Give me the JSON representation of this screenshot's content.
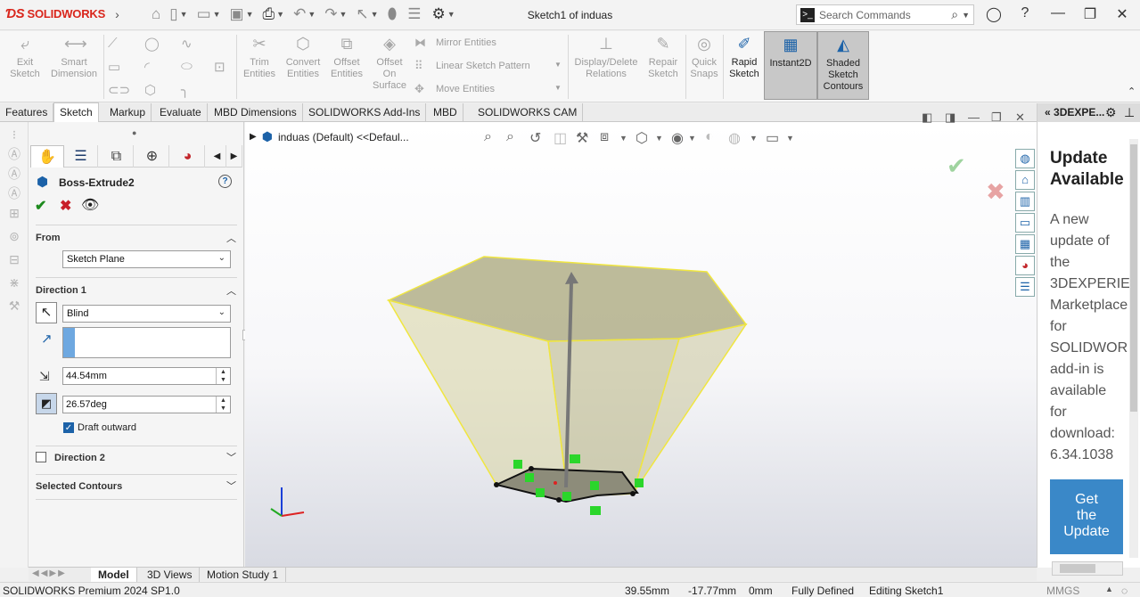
{
  "app": {
    "brand": "SOLIDWORKS",
    "title": "Sketch1 of induas"
  },
  "search": {
    "placeholder": "Search Commands"
  },
  "ribbon": {
    "exit_sketch": "Exit\nSketch",
    "smart_dimension": "Smart\nDimension",
    "trim": "Trim\nEntities",
    "convert": "Convert\nEntities",
    "offset": "Offset\nEntities",
    "offset_surface": "Offset\nOn\nSurface",
    "mirror": "Mirror Entities",
    "linear_pattern": "Linear Sketch Pattern",
    "move": "Move Entities",
    "display_delete": "Display/Delete\nRelations",
    "repair": "Repair\nSketch",
    "quick_snaps": "Quick\nSnaps",
    "rapid": "Rapid\nSketch",
    "instant2d": "Instant2D",
    "shaded": "Shaded\nSketch\nContours"
  },
  "tabs": [
    "Features",
    "Sketch",
    "Markup",
    "Evaluate",
    "MBD Dimensions",
    "SOLIDWORKS Add-Ins",
    "MBD",
    "SOLIDWORKS CAM"
  ],
  "property_manager": {
    "feature_name": "Boss-Extrude2",
    "from_label": "From",
    "from_value": "Sketch Plane",
    "direction1_label": "Direction 1",
    "direction1_type": "Blind",
    "depth": "44.54mm",
    "draft_angle": "26.57deg",
    "draft_outward_label": "Draft outward",
    "draft_outward_checked": true,
    "direction2_label": "Direction 2",
    "selected_contours_label": "Selected Contours"
  },
  "viewport": {
    "tree_path": "induas (Default) <<Defaul..."
  },
  "task_pane": {
    "header": "3DEXPE...",
    "title": "Update\nAvailable",
    "body": "A new\nupdate of\nthe\n3DEXPERIE\nMarketplace\nfor\nSOLIDWOR\nadd-in is\navailable\nfor\ndownload:\n6.34.1038",
    "button": "Get\nthe\nUpdate"
  },
  "bottom_tabs": [
    "Model",
    "3D Views",
    "Motion Study 1"
  ],
  "status": {
    "product": "SOLIDWORKS Premium 2024 SP1.0",
    "x": "39.55mm",
    "y": "-17.77mm",
    "z": "0mm",
    "state": "Fully Defined",
    "mode": "Editing Sketch1",
    "units": "MMGS"
  },
  "colors": {
    "accent": "#1c62a8",
    "brand_red": "#d9261c",
    "preview_fill": "#b7b58a",
    "preview_edge": "#f0e640",
    "update_button": "#3a88c8"
  }
}
